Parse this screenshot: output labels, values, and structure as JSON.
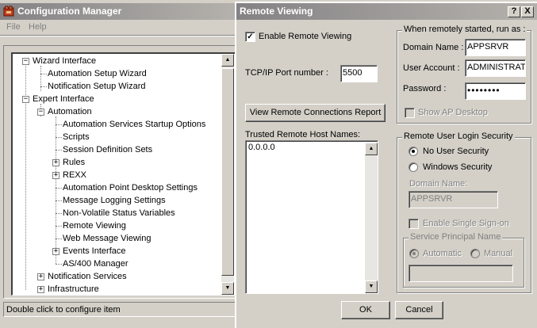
{
  "main_window": {
    "title": "Configuration Manager",
    "menu": {
      "file": "File",
      "help": "Help"
    },
    "tree": {
      "wizard_interface": "Wizard Interface",
      "automation_setup_wizard": "Automation Setup Wizard",
      "notification_setup_wizard": "Notification Setup Wizard",
      "expert_interface": "Expert Interface",
      "automation": "Automation",
      "automation_items": [
        "Automation Services Startup Options",
        "Scripts",
        "Session Definition Sets",
        "Rules",
        "REXX",
        "Automation Point Desktop Settings",
        "Message Logging Settings",
        "Non-Volatile Status Variables",
        "Remote Viewing",
        "Web Message Viewing",
        "Events Interface",
        "AS/400 Manager"
      ],
      "notification_services": "Notification Services",
      "infrastructure": "Infrastructure",
      "expand_glyph": "+",
      "collapse_glyph": "−"
    },
    "status": "Double click to configure item"
  },
  "dialog": {
    "title": "Remote Viewing",
    "help_btn": "?",
    "close_btn": "X",
    "enable_label": "Enable Remote Viewing",
    "enable_checked": true,
    "port_label": "TCP/IP Port number :",
    "port_value": "5500",
    "view_report_btn": "View Remote Connections Report",
    "trusted_label": "Trusted Remote Host Names:",
    "trusted_hosts": [
      "0.0.0.0"
    ],
    "run_as_group": {
      "title": "When remotely started, run as :",
      "domain_label": "Domain Name :",
      "domain_value": "APPSRVR",
      "account_label": "User Account :",
      "account_value": "ADMINISTRAT",
      "password_label": "Password :",
      "password_value": "••••••••",
      "show_desktop_label": "Show AP Desktop"
    },
    "login_security_group": {
      "title": "Remote User Login Security",
      "no_security_label": "No User Security",
      "windows_security_label": "Windows Security",
      "selected": "no_security",
      "domain_label": "Domain Name:",
      "domain_value": "APPSRVR",
      "sso_label": "Enable Single Sign-on",
      "spn_group": {
        "title": "Service Principal Name",
        "automatic_label": "Automatic",
        "manual_label": "Manual",
        "selected": "automatic"
      }
    },
    "ok_btn": "OK",
    "cancel_btn": "Cancel"
  },
  "colors": {
    "face": "#d4d0c8",
    "title_gradient_start": "#848284",
    "title_gradient_end": "#b5b2ad",
    "disabled_text": "#808080"
  }
}
